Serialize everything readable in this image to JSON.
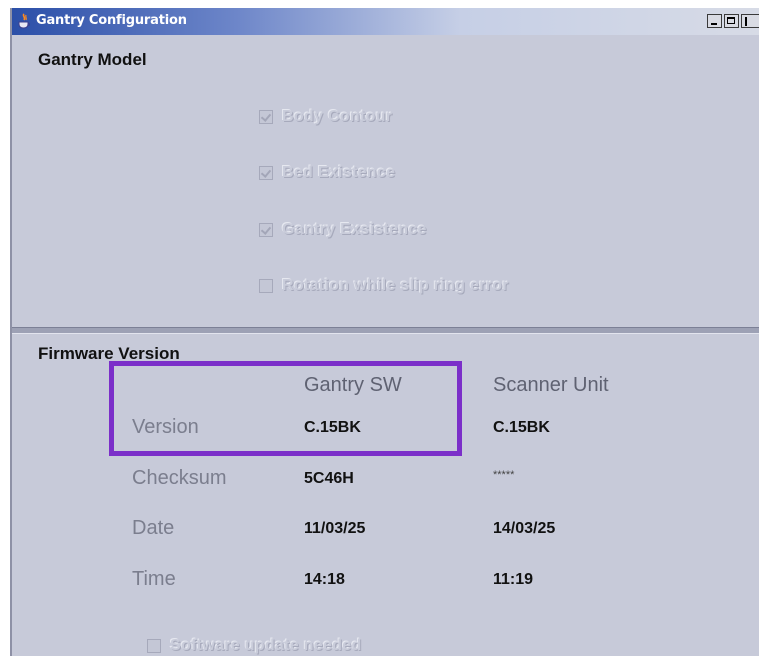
{
  "window": {
    "title": "Gantry Configuration"
  },
  "gantry_model": {
    "title": "Gantry Model",
    "checkboxes": [
      {
        "label": "Body Contour",
        "checked": true,
        "enabled": false
      },
      {
        "label": "Bed Existence",
        "checked": true,
        "enabled": false
      },
      {
        "label": "Gantry Exsistence",
        "checked": true,
        "enabled": false
      },
      {
        "label": "Rotation while slip ring error",
        "checked": false,
        "enabled": false
      }
    ]
  },
  "firmware": {
    "title": "Firmware Version",
    "columns": [
      "Gantry SW",
      "Scanner Unit"
    ],
    "rows": [
      {
        "label": "Version",
        "gantry_sw": "C.15BK",
        "scanner_unit": "C.15BK"
      },
      {
        "label": "Checksum",
        "gantry_sw": "5C46H",
        "scanner_unit": "*****"
      },
      {
        "label": "Date",
        "gantry_sw": "11/03/25",
        "scanner_unit": "14/03/25"
      },
      {
        "label": "Time",
        "gantry_sw": "14:18",
        "scanner_unit": "11:19"
      }
    ],
    "software_update": {
      "label": "Software update needed",
      "checked": false,
      "enabled": false
    }
  },
  "colors": {
    "highlight_box": "#7b2fc9",
    "window_bg": "#c7cad9",
    "titlebar": "#2b4fa8"
  }
}
